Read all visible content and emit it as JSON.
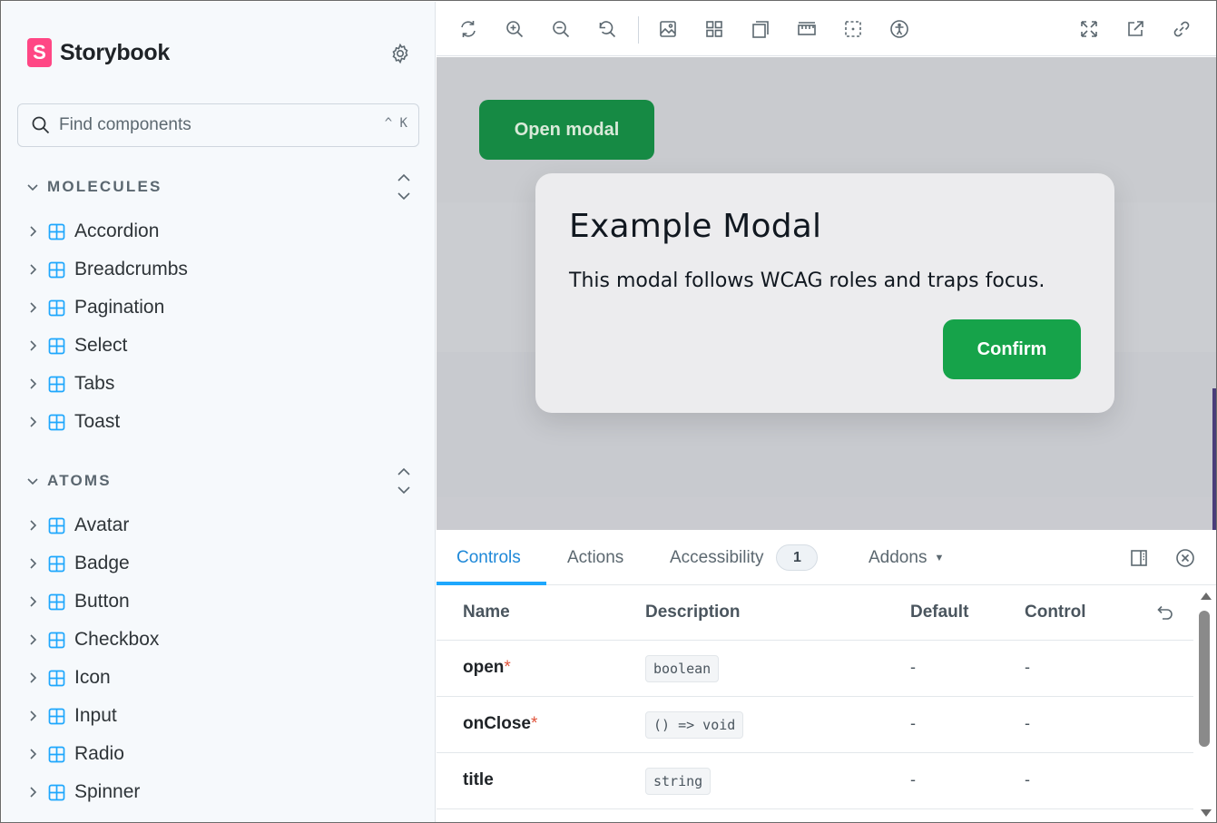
{
  "sidebar": {
    "brand": "Storybook",
    "brand_logo_letter": "S",
    "search": {
      "placeholder": "Find components",
      "shortcut": "^ K"
    },
    "sections": [
      {
        "title": "MOLECULES",
        "items": [
          "Accordion",
          "Breadcrumbs",
          "Pagination",
          "Select",
          "Tabs",
          "Toast"
        ]
      },
      {
        "title": "ATOMS",
        "items": [
          "Avatar",
          "Badge",
          "Button",
          "Checkbox",
          "Icon",
          "Input",
          "Radio",
          "Spinner"
        ]
      }
    ]
  },
  "toolbar": {
    "left_icons": [
      "reload-icon",
      "zoom-in-icon",
      "zoom-out-icon",
      "reset-zoom-icon",
      "background-icon",
      "grid-icon",
      "viewport-icon",
      "measure-icon",
      "outline-icon",
      "accessibility-icon"
    ],
    "right_icons": [
      "fullscreen-icon",
      "open-new-tab-icon",
      "copy-link-icon"
    ]
  },
  "canvas": {
    "open_button": "Open modal",
    "modal": {
      "title": "Example Modal",
      "body": "This modal follows WCAG roles and traps focus.",
      "confirm": "Confirm"
    }
  },
  "panel": {
    "tabs": [
      {
        "label": "Controls",
        "active": true
      },
      {
        "label": "Actions",
        "active": false
      },
      {
        "label": "Accessibility",
        "active": false,
        "badge": "1"
      },
      {
        "label": "Addons",
        "active": false
      }
    ],
    "columns": {
      "name": "Name",
      "description": "Description",
      "default": "Default",
      "control": "Control"
    },
    "rows": [
      {
        "name": "open",
        "required": "*",
        "type": "boolean",
        "default": "-",
        "control": "-"
      },
      {
        "name": "onClose",
        "required": "*",
        "type": "() => void",
        "default": "-",
        "control": "-"
      },
      {
        "name": "title",
        "required": "",
        "type": "string",
        "default": "-",
        "control": "-"
      }
    ]
  },
  "colors": {
    "accent": "#1ea7fd",
    "storybook_pink": "#ff4785",
    "open_button": "#168a44",
    "confirm_button": "#16a34a",
    "required_marker": "#e0533a"
  }
}
